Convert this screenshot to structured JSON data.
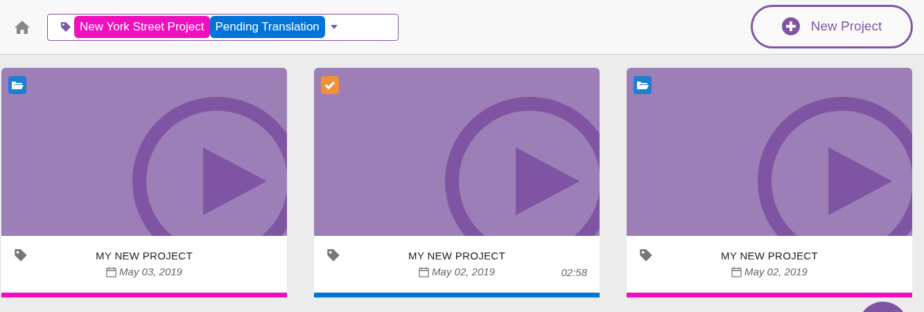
{
  "filter": {
    "tags": [
      {
        "label": "New York Street Project",
        "color": "#f00fbe"
      },
      {
        "label": "Pending Translation",
        "color": "#0074d9"
      }
    ]
  },
  "new_project_button": {
    "label": "New Project"
  },
  "projects": [
    {
      "title": "MY NEW PROJECT",
      "date": "May 03, 2019",
      "kind": "folder",
      "color": "#f00fbe"
    },
    {
      "title": "MY NEW PROJECT",
      "date": "May 02, 2019",
      "duration": "02:58",
      "kind": "done",
      "color": "#0074d9"
    },
    {
      "title": "MY NEW PROJECT",
      "date": "May 02, 2019",
      "kind": "folder",
      "color": "#f00fbe"
    }
  ]
}
